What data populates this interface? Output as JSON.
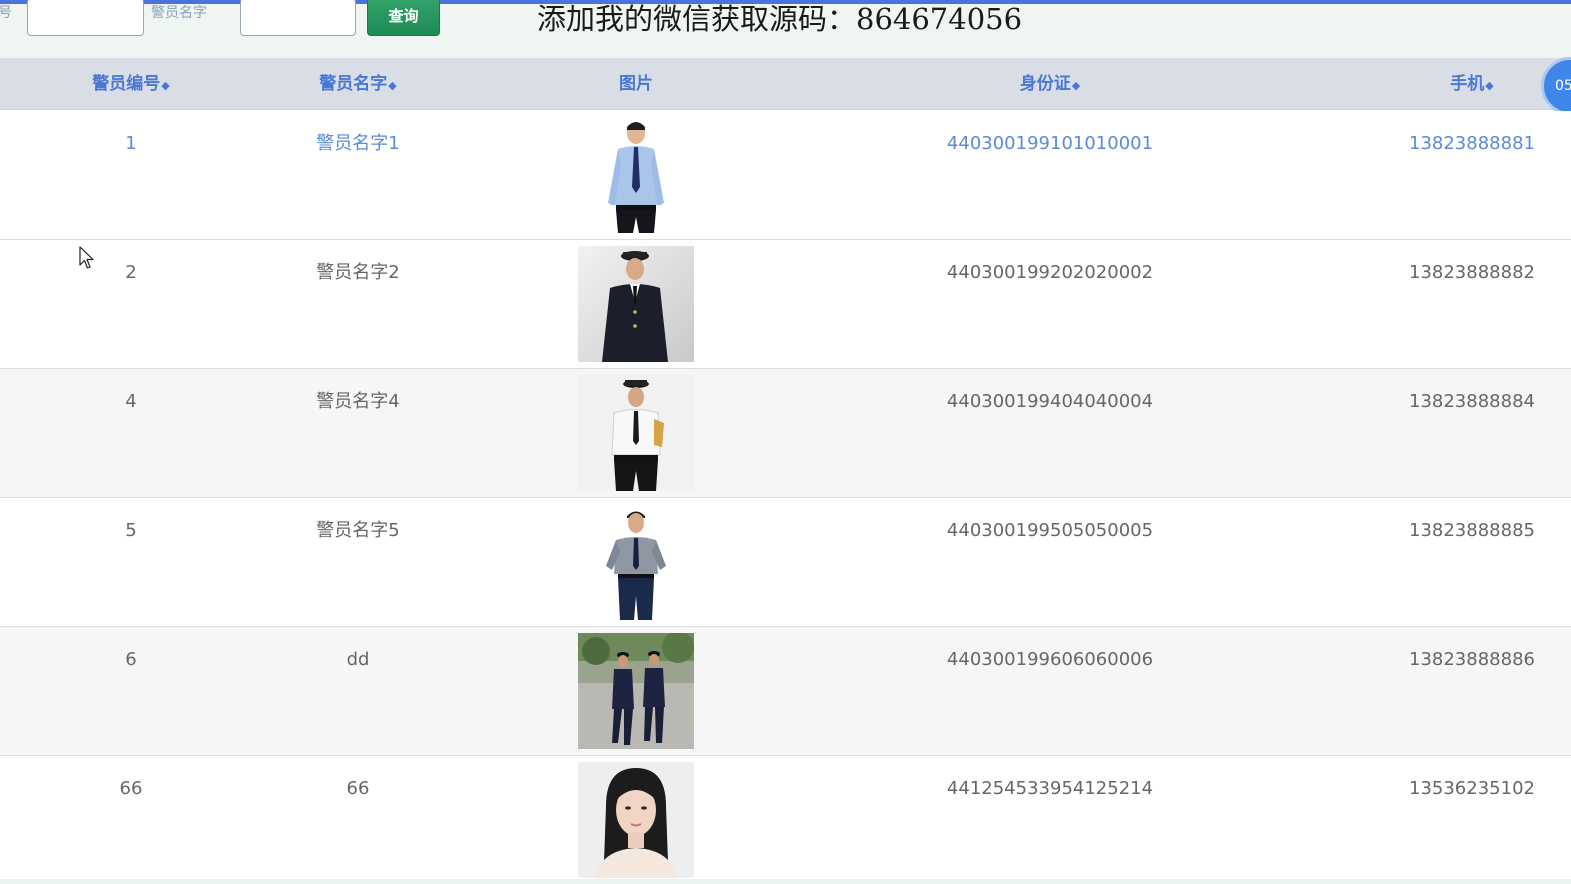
{
  "search": {
    "cut_label": "号",
    "name_label": "警员名字",
    "id_value": "",
    "name_value": "",
    "query_button": "查询"
  },
  "watermark": "添加我的微信获取源码：864674056",
  "table": {
    "headers": {
      "id": "警员编号",
      "name": "警员名字",
      "photo": "图片",
      "idcard": "身份证",
      "phone": "手机"
    },
    "sort_icon": "sort-icon",
    "rows": [
      {
        "id": "1",
        "name": "警员名字1",
        "idcard": "440300199101010001",
        "phone": "13823888881",
        "photo": "police-light-blue-shirt"
      },
      {
        "id": "2",
        "name": "警员名字2",
        "idcard": "440300199202020002",
        "phone": "13823888882",
        "photo": "police-dark-uniform"
      },
      {
        "id": "4",
        "name": "警员名字4",
        "idcard": "440300199404040004",
        "phone": "13823888884",
        "photo": "police-white-shirt"
      },
      {
        "id": "5",
        "name": "警员名字5",
        "idcard": "440300199505050005",
        "phone": "13823888885",
        "photo": "security-grey-shirt"
      },
      {
        "id": "6",
        "name": "dd",
        "idcard": "440300199606060006",
        "phone": "13823888886",
        "photo": "two-officers-walking"
      },
      {
        "id": "66",
        "name": "66",
        "idcard": "441254533954125214",
        "phone": "13536235102",
        "photo": "woman-portrait"
      }
    ]
  },
  "float_badge": "05",
  "colors": {
    "header_text": "#4a77d4",
    "header_bg": "#d9dee6",
    "query_button": "#1d8a52",
    "highlight_row_text": "#5a8ad8",
    "top_accent": "#4a73e0"
  }
}
